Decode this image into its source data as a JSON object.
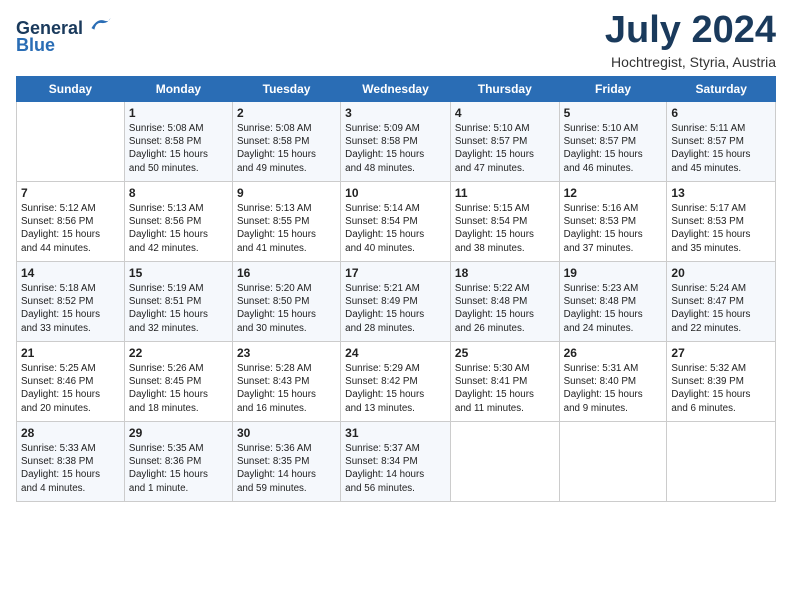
{
  "logo": {
    "line1": "General",
    "line2": "Blue"
  },
  "title": "July 2024",
  "subtitle": "Hochtregist, Styria, Austria",
  "headers": [
    "Sunday",
    "Monday",
    "Tuesday",
    "Wednesday",
    "Thursday",
    "Friday",
    "Saturday"
  ],
  "weeks": [
    [
      {
        "day": "",
        "info": ""
      },
      {
        "day": "1",
        "info": "Sunrise: 5:08 AM\nSunset: 8:58 PM\nDaylight: 15 hours\nand 50 minutes."
      },
      {
        "day": "2",
        "info": "Sunrise: 5:08 AM\nSunset: 8:58 PM\nDaylight: 15 hours\nand 49 minutes."
      },
      {
        "day": "3",
        "info": "Sunrise: 5:09 AM\nSunset: 8:58 PM\nDaylight: 15 hours\nand 48 minutes."
      },
      {
        "day": "4",
        "info": "Sunrise: 5:10 AM\nSunset: 8:57 PM\nDaylight: 15 hours\nand 47 minutes."
      },
      {
        "day": "5",
        "info": "Sunrise: 5:10 AM\nSunset: 8:57 PM\nDaylight: 15 hours\nand 46 minutes."
      },
      {
        "day": "6",
        "info": "Sunrise: 5:11 AM\nSunset: 8:57 PM\nDaylight: 15 hours\nand 45 minutes."
      }
    ],
    [
      {
        "day": "7",
        "info": "Sunrise: 5:12 AM\nSunset: 8:56 PM\nDaylight: 15 hours\nand 44 minutes."
      },
      {
        "day": "8",
        "info": "Sunrise: 5:13 AM\nSunset: 8:56 PM\nDaylight: 15 hours\nand 42 minutes."
      },
      {
        "day": "9",
        "info": "Sunrise: 5:13 AM\nSunset: 8:55 PM\nDaylight: 15 hours\nand 41 minutes."
      },
      {
        "day": "10",
        "info": "Sunrise: 5:14 AM\nSunset: 8:54 PM\nDaylight: 15 hours\nand 40 minutes."
      },
      {
        "day": "11",
        "info": "Sunrise: 5:15 AM\nSunset: 8:54 PM\nDaylight: 15 hours\nand 38 minutes."
      },
      {
        "day": "12",
        "info": "Sunrise: 5:16 AM\nSunset: 8:53 PM\nDaylight: 15 hours\nand 37 minutes."
      },
      {
        "day": "13",
        "info": "Sunrise: 5:17 AM\nSunset: 8:53 PM\nDaylight: 15 hours\nand 35 minutes."
      }
    ],
    [
      {
        "day": "14",
        "info": "Sunrise: 5:18 AM\nSunset: 8:52 PM\nDaylight: 15 hours\nand 33 minutes."
      },
      {
        "day": "15",
        "info": "Sunrise: 5:19 AM\nSunset: 8:51 PM\nDaylight: 15 hours\nand 32 minutes."
      },
      {
        "day": "16",
        "info": "Sunrise: 5:20 AM\nSunset: 8:50 PM\nDaylight: 15 hours\nand 30 minutes."
      },
      {
        "day": "17",
        "info": "Sunrise: 5:21 AM\nSunset: 8:49 PM\nDaylight: 15 hours\nand 28 minutes."
      },
      {
        "day": "18",
        "info": "Sunrise: 5:22 AM\nSunset: 8:48 PM\nDaylight: 15 hours\nand 26 minutes."
      },
      {
        "day": "19",
        "info": "Sunrise: 5:23 AM\nSunset: 8:48 PM\nDaylight: 15 hours\nand 24 minutes."
      },
      {
        "day": "20",
        "info": "Sunrise: 5:24 AM\nSunset: 8:47 PM\nDaylight: 15 hours\nand 22 minutes."
      }
    ],
    [
      {
        "day": "21",
        "info": "Sunrise: 5:25 AM\nSunset: 8:46 PM\nDaylight: 15 hours\nand 20 minutes."
      },
      {
        "day": "22",
        "info": "Sunrise: 5:26 AM\nSunset: 8:45 PM\nDaylight: 15 hours\nand 18 minutes."
      },
      {
        "day": "23",
        "info": "Sunrise: 5:28 AM\nSunset: 8:43 PM\nDaylight: 15 hours\nand 16 minutes."
      },
      {
        "day": "24",
        "info": "Sunrise: 5:29 AM\nSunset: 8:42 PM\nDaylight: 15 hours\nand 13 minutes."
      },
      {
        "day": "25",
        "info": "Sunrise: 5:30 AM\nSunset: 8:41 PM\nDaylight: 15 hours\nand 11 minutes."
      },
      {
        "day": "26",
        "info": "Sunrise: 5:31 AM\nSunset: 8:40 PM\nDaylight: 15 hours\nand 9 minutes."
      },
      {
        "day": "27",
        "info": "Sunrise: 5:32 AM\nSunset: 8:39 PM\nDaylight: 15 hours\nand 6 minutes."
      }
    ],
    [
      {
        "day": "28",
        "info": "Sunrise: 5:33 AM\nSunset: 8:38 PM\nDaylight: 15 hours\nand 4 minutes."
      },
      {
        "day": "29",
        "info": "Sunrise: 5:35 AM\nSunset: 8:36 PM\nDaylight: 15 hours\nand 1 minute."
      },
      {
        "day": "30",
        "info": "Sunrise: 5:36 AM\nSunset: 8:35 PM\nDaylight: 14 hours\nand 59 minutes."
      },
      {
        "day": "31",
        "info": "Sunrise: 5:37 AM\nSunset: 8:34 PM\nDaylight: 14 hours\nand 56 minutes."
      },
      {
        "day": "",
        "info": ""
      },
      {
        "day": "",
        "info": ""
      },
      {
        "day": "",
        "info": ""
      }
    ]
  ]
}
